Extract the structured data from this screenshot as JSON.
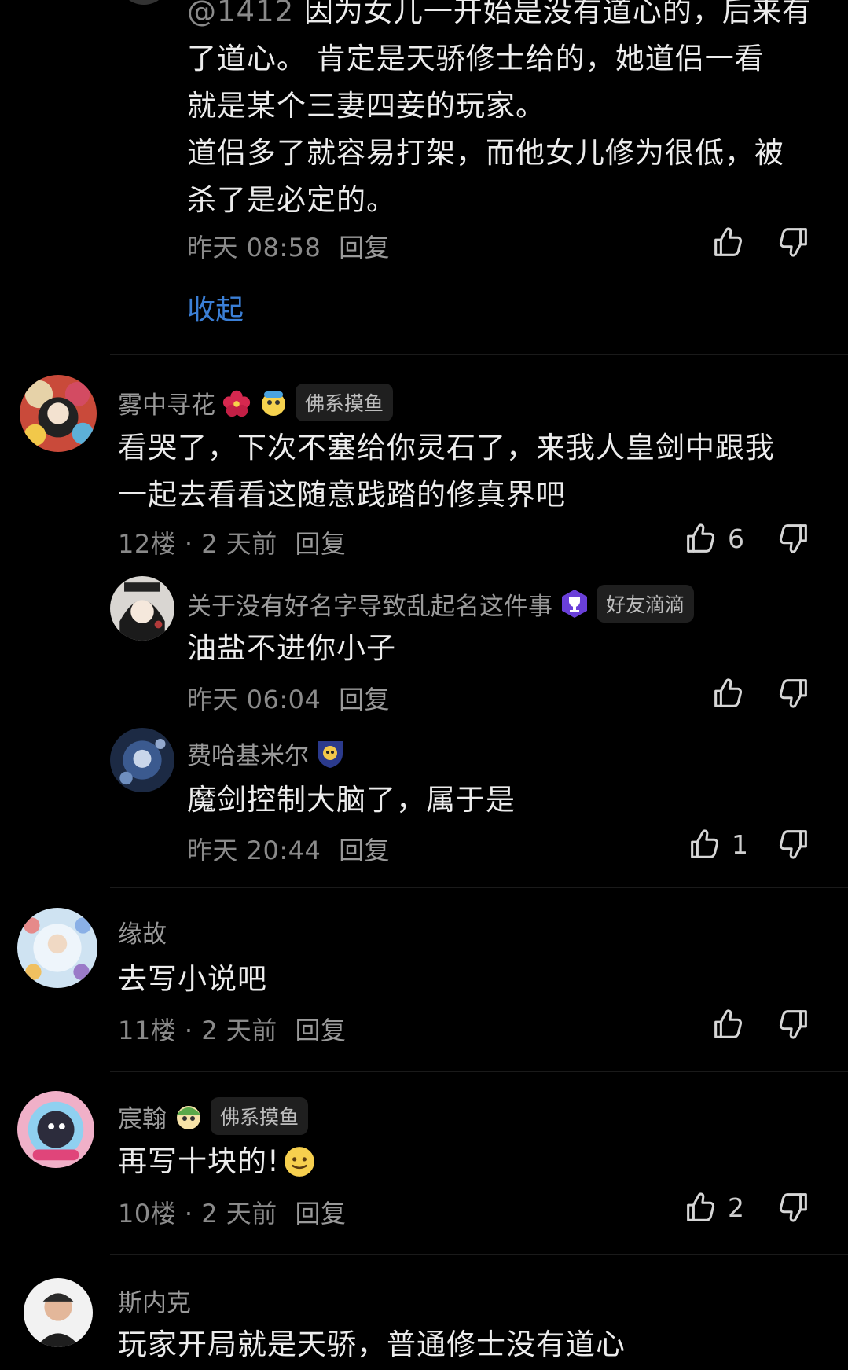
{
  "comments": {
    "top_reply": {
      "mention": "@1412",
      "lines": [
        "因为女儿一开始是没有道心的，后来有",
        "了道心。    肯定是天骄修士给的，她道侣一看",
        "就是某个三妻四妾的玩家。",
        "道侣多了就容易打架，而他女儿修为很低，被",
        "杀了是必定的。"
      ],
      "meta": "昨天 08:58",
      "reply_label": "回复",
      "collapse_label": "收起"
    },
    "c12": {
      "username": "雾中寻花",
      "badge": "佛系摸鱼",
      "lines": [
        "看哭了，下次不塞给你灵石了，来我人皇剑中跟我",
        "一起去看看这随意践踏的修真界吧"
      ],
      "floor": "12楼",
      "time": "2 天前",
      "reply_label": "回复",
      "likes": "6"
    },
    "c12_r1": {
      "username": "关于没有好名字导致乱起名这件事",
      "badge": "好友滴滴",
      "text": "油盐不进你小子",
      "meta": "昨天 06:04",
      "reply_label": "回复"
    },
    "c12_r2": {
      "username": "费哈基米尔",
      "text": "魔剑控制大脑了，属于是",
      "meta": "昨天 20:44",
      "reply_label": "回复",
      "likes": "1"
    },
    "c11": {
      "username": "缘故",
      "text": "去写小说吧",
      "floor": "11楼",
      "time": "2 天前",
      "reply_label": "回复"
    },
    "c10": {
      "username": "宸翰",
      "badge": "佛系摸鱼",
      "text": "再写十块的!",
      "floor": "10楼",
      "time": "2 天前",
      "reply_label": "回复",
      "likes": "2"
    },
    "c9": {
      "username": "斯内克",
      "text": "玩家开局就是天骄，普通修士没有道心"
    }
  },
  "icons": {
    "like": "thumbs-up-icon",
    "dislike": "thumbs-down-icon"
  },
  "colors": {
    "background": "#000000",
    "link_blue": "#3b7fd6",
    "badge_bg": "#1f1f1f"
  }
}
